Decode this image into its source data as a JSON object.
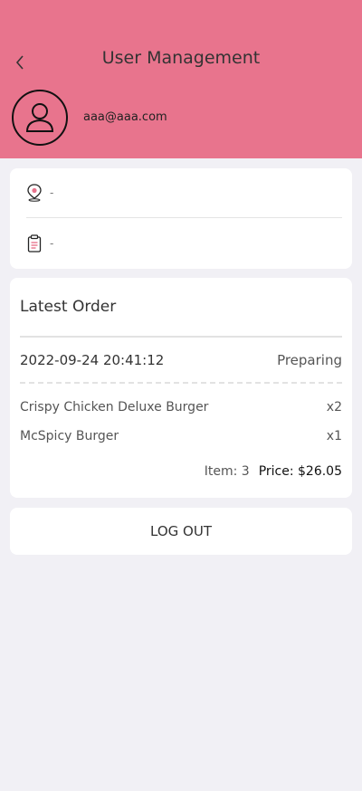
{
  "header": {
    "title": "User Management",
    "back_icon": "chevron-left-icon",
    "email": "aaa@aaa.com",
    "bg_color": "#e8748d"
  },
  "info": {
    "address": "-",
    "note": "-"
  },
  "order": {
    "title": "Latest Order",
    "datetime": "2022-09-24 20:41:12",
    "status": "Preparing",
    "items": [
      {
        "name": "Crispy Chicken Deluxe Burger",
        "qty": "x2"
      },
      {
        "name": "McSpicy Burger",
        "qty": "x1"
      }
    ],
    "item_count": "Item: 3",
    "price": "Price: $26.05"
  },
  "logout": {
    "label": "LOG OUT"
  }
}
